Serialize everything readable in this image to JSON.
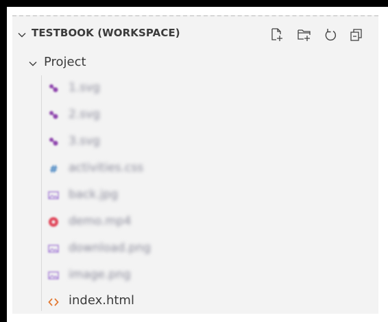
{
  "explorer": {
    "section_title": "TESTBOOK (WORKSPACE)",
    "actions": [
      {
        "name": "new-file-icon",
        "label": "New File"
      },
      {
        "name": "new-folder-icon",
        "label": "New Folder"
      },
      {
        "name": "refresh-icon",
        "label": "Refresh Explorer"
      },
      {
        "name": "collapse-all-icon",
        "label": "Collapse Folders in Explorer"
      }
    ],
    "folder": {
      "label": "Project",
      "expanded": true
    },
    "files": [
      {
        "label": "1.svg",
        "icon": "svg-file-icon",
        "color": "#8e44ad",
        "blurred": true
      },
      {
        "label": "2.svg",
        "icon": "svg-file-icon",
        "color": "#8e44ad",
        "blurred": true
      },
      {
        "label": "3.svg",
        "icon": "svg-file-icon",
        "color": "#8e44ad",
        "blurred": true
      },
      {
        "label": "activities.css",
        "icon": "css-file-icon",
        "color": "#3b7ebf",
        "blurred": true
      },
      {
        "label": "back.jpg",
        "icon": "image-file-icon",
        "color": "#a57fd6",
        "blurred": true
      },
      {
        "label": "demo.mp4",
        "icon": "video-file-icon",
        "color": "#e0475a",
        "blurred": true
      },
      {
        "label": "download.png",
        "icon": "image-file-icon",
        "color": "#a57fd6",
        "blurred": true
      },
      {
        "label": "image.png",
        "icon": "image-file-icon",
        "color": "#a57fd6",
        "blurred": true
      },
      {
        "label": "index.html",
        "icon": "html-file-icon",
        "color": "#e37933",
        "blurred": false
      }
    ]
  },
  "colors": {
    "background": "#f3f3f3",
    "text": "#3b3b3b",
    "frame": "#000000"
  }
}
